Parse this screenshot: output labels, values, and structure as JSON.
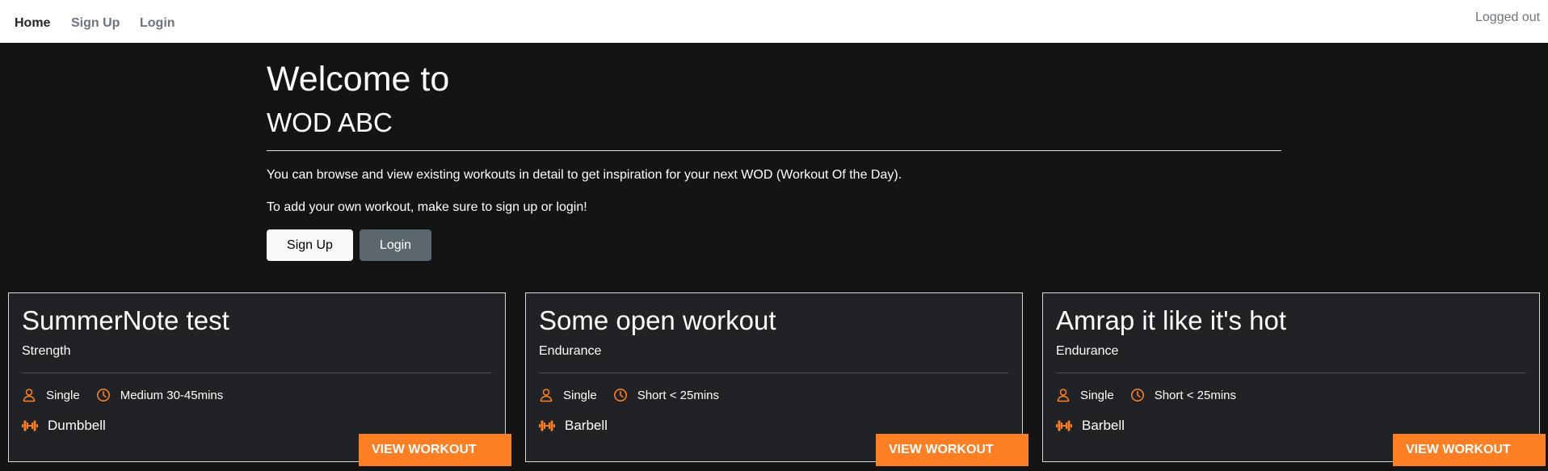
{
  "nav": {
    "home": "Home",
    "signup": "Sign Up",
    "login": "Login",
    "status": "Logged out"
  },
  "hero": {
    "title_line1": "Welcome to",
    "title_line2": "WOD ABC",
    "text1": "You can browse and view existing workouts in detail to get inspiration for your next WOD (Workout Of the Day).",
    "text2": "To add your own workout, make sure to sign up or login!",
    "signup_button": "Sign Up",
    "login_button": "Login"
  },
  "colors": {
    "accent": "#fd7e23",
    "background": "#141414",
    "card": "#212226"
  },
  "cards": [
    {
      "title": "SummerNote test",
      "category": "Strength",
      "participants": "Single",
      "participants_icon": "person-icon",
      "duration": "Medium 30-45mins",
      "duration_icon": "clock-icon",
      "equipment": "Dumbbell",
      "equipment_icon": "dumbbell-icon",
      "button": "VIEW WORKOUT"
    },
    {
      "title": "Some open workout",
      "category": "Endurance",
      "participants": "Single",
      "participants_icon": "person-icon",
      "duration": "Short < 25mins",
      "duration_icon": "clock-icon",
      "equipment": "Barbell",
      "equipment_icon": "dumbbell-icon",
      "button": "VIEW WORKOUT"
    },
    {
      "title": "Amrap it like it's hot",
      "category": "Endurance",
      "participants": "Single",
      "participants_icon": "person-icon",
      "duration": "Short < 25mins",
      "duration_icon": "clock-icon",
      "equipment": "Barbell",
      "equipment_icon": "dumbbell-icon",
      "button": "VIEW WORKOUT"
    }
  ]
}
